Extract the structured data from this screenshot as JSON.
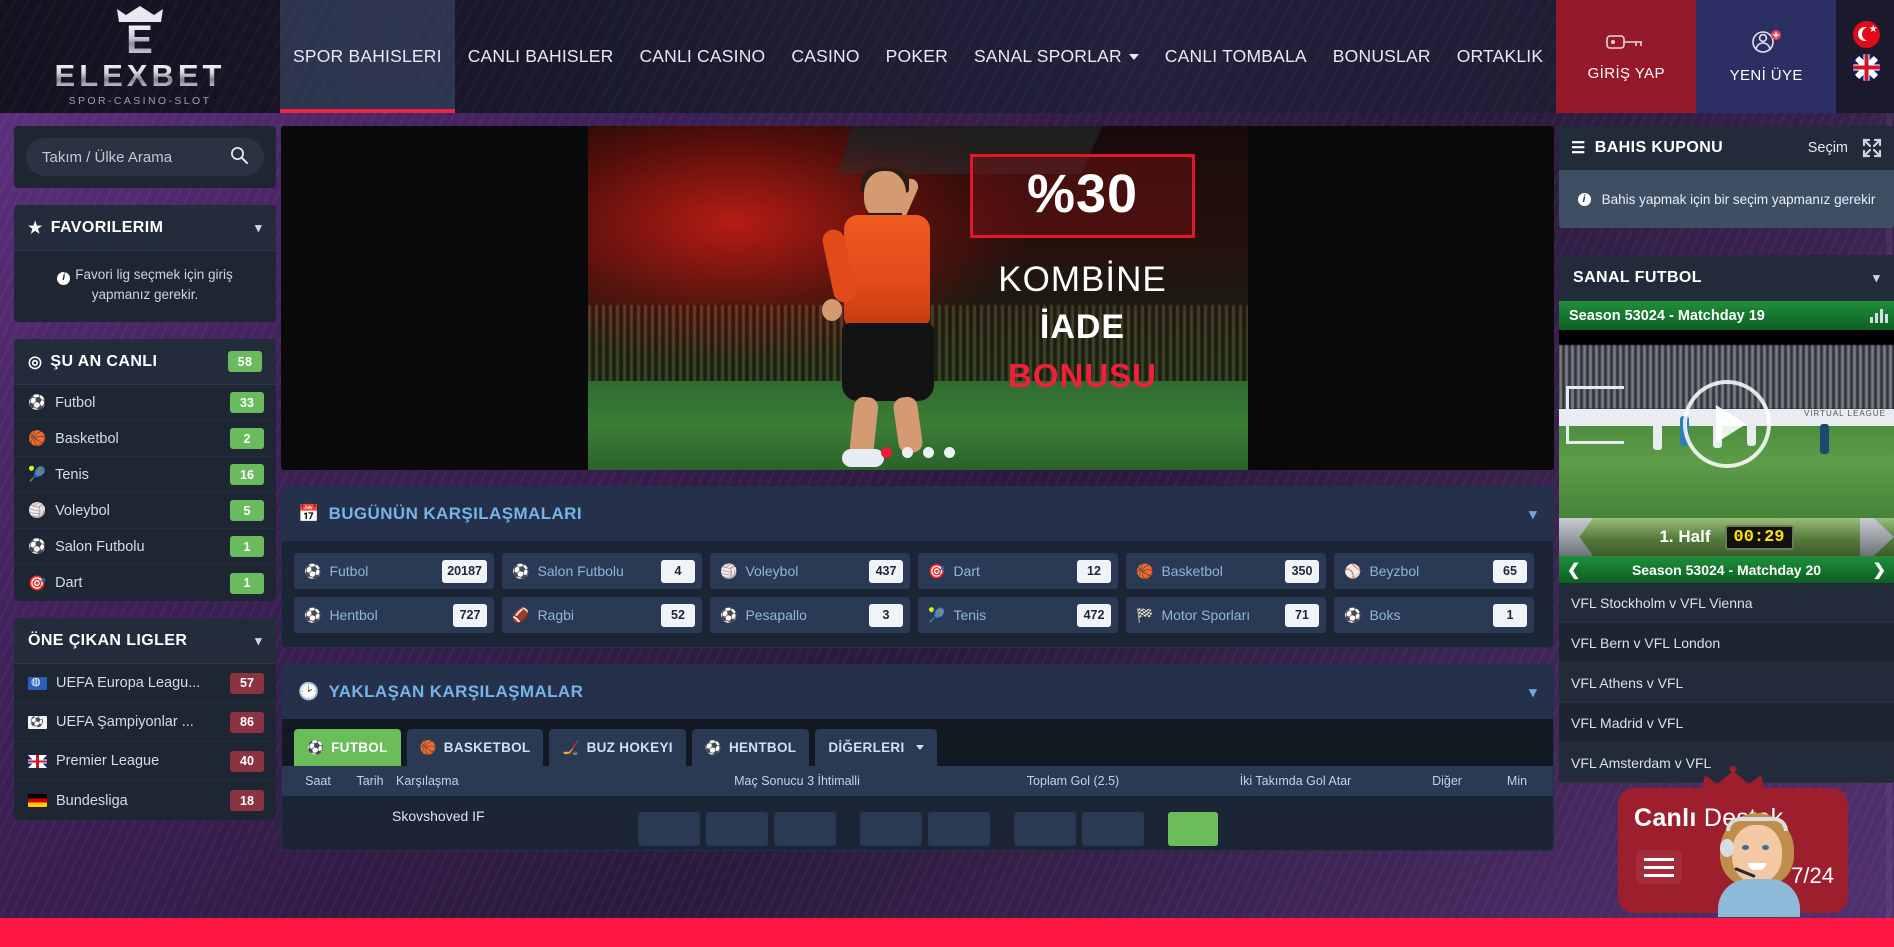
{
  "brand": {
    "name": "ELEXBET",
    "initial": "E",
    "tagline": "SPOR-CASINO-SLOT"
  },
  "header": {
    "nav": [
      {
        "label": "SPOR BAHISLERI",
        "active": true,
        "caret": false
      },
      {
        "label": "CANLI BAHISLER",
        "active": false,
        "caret": false
      },
      {
        "label": "CANLI CASINO",
        "active": false,
        "caret": false
      },
      {
        "label": "CASINO",
        "active": false,
        "caret": false
      },
      {
        "label": "POKER",
        "active": false,
        "caret": false
      },
      {
        "label": "SANAL SPORLAR",
        "active": false,
        "caret": true
      },
      {
        "label": "CANLI TOMBALA",
        "active": false,
        "caret": false
      },
      {
        "label": "BONUSLAR",
        "active": false,
        "caret": false
      },
      {
        "label": "ORTAKLIK",
        "active": false,
        "caret": false
      }
    ],
    "login_label": "GİRİŞ YAP",
    "login_icon": "key-icon",
    "signup_label": "YENİ ÜYE",
    "signup_icon": "user-add-icon",
    "languages": [
      "flag-tr",
      "flag-gb"
    ],
    "accent_red": "#ee2146",
    "login_bg": "#96182b",
    "signup_bg": "#2b2f63"
  },
  "sidebar": {
    "search": {
      "placeholder": "Takım / Ülke Arama",
      "icon": "search-icon",
      "value": ""
    },
    "favorites": {
      "title": "FAVORILERIM",
      "icon": "star-icon",
      "chevron": "chevron-down-icon",
      "note": "Favori lig seçmek için giriş yapmanız gerekir."
    },
    "live": {
      "title": "ŞU AN CANLI",
      "icon": "dot-circle-icon",
      "count": "58",
      "items": [
        {
          "label": "Futbol",
          "icon": "soccer-icon",
          "count": "33"
        },
        {
          "label": "Basketbol",
          "icon": "basketball-icon",
          "count": "2"
        },
        {
          "label": "Tenis",
          "icon": "tennis-icon",
          "count": "16"
        },
        {
          "label": "Voleybol",
          "icon": "volleyball-icon",
          "count": "5"
        },
        {
          "label": "Salon Futbolu",
          "icon": "futsal-icon",
          "count": "1"
        },
        {
          "label": "Dart",
          "icon": "dart-icon",
          "count": "1"
        }
      ]
    },
    "featured_leagues": {
      "title": "ÖNE ÇIKAN LIGLER",
      "chevron": "chevron-down-icon",
      "items": [
        {
          "label": "UEFA Europa Leagu...",
          "flag": "fl-eur",
          "count": "57"
        },
        {
          "label": "UEFA Şampiyonlar ...",
          "flag": "fl-ucl",
          "count": "86"
        },
        {
          "label": "Premier League",
          "flag": "fl-gb2",
          "count": "40"
        },
        {
          "label": "Bundesliga",
          "flag": "fl-de",
          "count": "18"
        }
      ]
    }
  },
  "banner": {
    "percent": "%30",
    "line1": "KOMBİNE",
    "line2": "İADE",
    "line3": "BONUSU",
    "dots": 4,
    "active_dot": 0
  },
  "today": {
    "title": "BUGÜNÜN KARŞILAŞMALARI",
    "icon": "calendar-icon",
    "chevron": "chevron-down-icon",
    "tiles": [
      {
        "label": "Futbol",
        "icon": "soccer-icon",
        "count": "20187"
      },
      {
        "label": "Salon Futbolu",
        "icon": "futsal-icon",
        "count": "4"
      },
      {
        "label": "Voleybol",
        "icon": "volleyball-icon",
        "count": "437"
      },
      {
        "label": "Dart",
        "icon": "dart-icon",
        "count": "12"
      },
      {
        "label": "Basketbol",
        "icon": "basketball-icon",
        "count": "350"
      },
      {
        "label": "Beyzbol",
        "icon": "baseball-icon",
        "count": "65"
      },
      {
        "label": "Hentbol",
        "icon": "handball-icon",
        "count": "727"
      },
      {
        "label": "Ragbi",
        "icon": "rugby-icon",
        "count": "52"
      },
      {
        "label": "Pesapallo",
        "icon": "pesapallo-icon",
        "count": "3"
      },
      {
        "label": "Tenis",
        "icon": "tennis-icon",
        "count": "472"
      },
      {
        "label": "Motor Sporları",
        "icon": "motorsport-icon",
        "count": "71"
      },
      {
        "label": "Boks",
        "icon": "boxing-icon",
        "count": "1"
      }
    ]
  },
  "upcoming": {
    "title": "YAKLAŞAN KARŞILAŞMALAR",
    "icon": "clock-icon",
    "chevron": "chevron-down-icon",
    "tabs": [
      {
        "label": "FUTBOL",
        "icon": "soccer-icon",
        "active": true,
        "caret": false
      },
      {
        "label": "BASKETBOL",
        "icon": "basketball-icon",
        "active": false,
        "caret": false
      },
      {
        "label": "BUZ HOKEYI",
        "icon": "hockey-icon",
        "active": false,
        "caret": false
      },
      {
        "label": "HENTBOL",
        "icon": "handball-icon",
        "active": false,
        "caret": false
      },
      {
        "label": "DİĞERLERI",
        "icon": "",
        "active": false,
        "caret": true
      }
    ],
    "columns": {
      "saat": "Saat",
      "tarih": "Tarih",
      "karsilasma": "Karşılaşma",
      "mac_sonucu": "Maç Sonucu 3 İhtimalli",
      "toplam_gol": "Toplam Gol (2.5)",
      "iki_takim": "İki Takımda Gol Atar",
      "diger": "Diğer",
      "min": "Min"
    },
    "first_row_team": "Skovshoved IF"
  },
  "coupon": {
    "title": "BAHIS KUPONU",
    "icon": "list-icon",
    "selection_label": "Seçim",
    "expand_icon": "expand-icon",
    "empty_message": "Bahis yapmak için bir seçim yapmanız gerekir",
    "info_icon": "info-icon"
  },
  "virtual": {
    "title": "SANAL FUTBOL",
    "chevron": "chevron-down-icon",
    "current_matchday": "Season 53024 - Matchday 19",
    "stats_icon": "bar-chart-icon",
    "play_icon": "play-icon",
    "half_label": "1. Half",
    "clock": "00:29",
    "next_matchday": "Season 53024 - Matchday 20",
    "prev_icon": "chevron-left-icon",
    "next_icon": "chevron-right-icon",
    "fixtures": [
      "VFL Stockholm v VFL Vienna",
      "VFL Bern v VFL London",
      "VFL Athens v VFL",
      "VFL Madrid v VFL",
      "VFL Amsterdam v VFL"
    ]
  },
  "support": {
    "title_bold": "Canlı",
    "title_rest": " Destek",
    "hours": "7/24",
    "icon": "headset-agent-icon",
    "bg": "#9d1f2e"
  }
}
